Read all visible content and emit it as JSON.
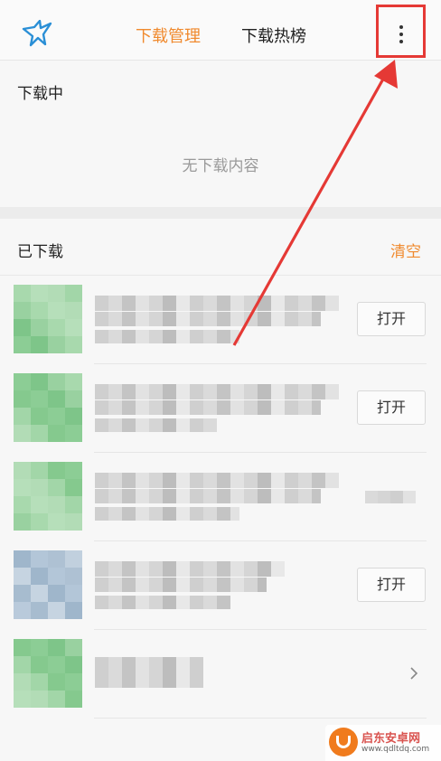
{
  "header": {
    "tabs": [
      {
        "label": "下载管理",
        "active": true
      },
      {
        "label": "下载热榜",
        "active": false
      }
    ],
    "logo_icon": "bird-logo-icon",
    "more_icon": "more-vertical-icon"
  },
  "downloading": {
    "title": "下载中",
    "empty_text": "无下载内容"
  },
  "downloaded": {
    "title": "已下载",
    "clear_label": "清空",
    "items": [
      {
        "action": "打开",
        "thumb_color": "green"
      },
      {
        "action": "打开",
        "thumb_color": "green"
      },
      {
        "action": "",
        "thumb_color": "green"
      },
      {
        "action": "打开",
        "thumb_color": "blue"
      },
      {
        "action": "",
        "thumb_color": "green",
        "trailing_icon": "chevron-right-icon"
      }
    ]
  },
  "watermark": {
    "title": "启东安卓网",
    "url": "www.qdltdq.com"
  },
  "colors": {
    "accent": "#f08a2e",
    "highlight_box": "#e53935"
  }
}
